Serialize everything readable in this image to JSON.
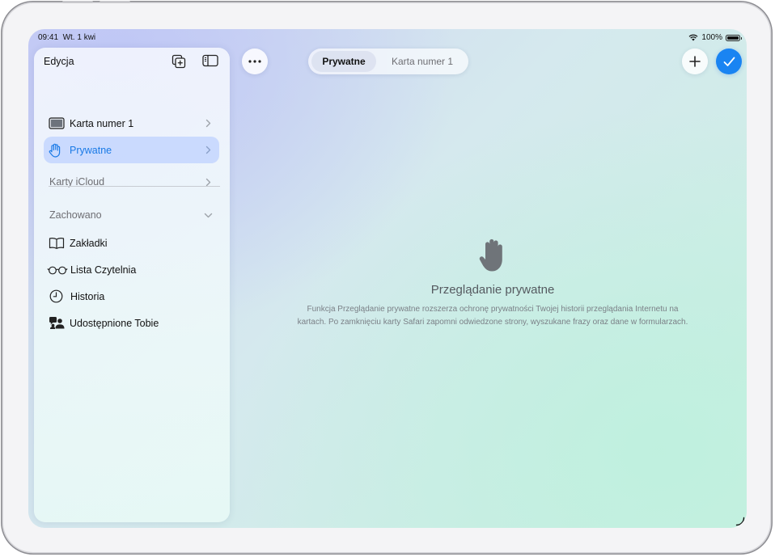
{
  "status_bar": {
    "time": "09:41",
    "date": "Wt. 1 kwi",
    "battery_percent": "100%",
    "battery_level": 1.0
  },
  "sidebar": {
    "edit_label": "Edycja",
    "tab_groups": [
      {
        "label": "Karta numer 1",
        "icon": "tablet-icon",
        "selected": false
      },
      {
        "label": "Prywatne",
        "icon": "hand-icon",
        "selected": true
      }
    ],
    "icloud_tabs_label": "Karty iCloud",
    "saved_section_label": "Zachowano",
    "saved_items": [
      {
        "label": "Zakładki",
        "icon": "book-icon"
      },
      {
        "label": "Lista Czytelnia",
        "icon": "glasses-icon"
      },
      {
        "label": "Historia",
        "icon": "clock-icon"
      },
      {
        "label": "Udostępnione Tobie",
        "icon": "shared-people-icon"
      }
    ]
  },
  "toolbar": {
    "segments": [
      "Prywatne",
      "Karta numer 1"
    ],
    "selected_segment": "Prywatne"
  },
  "empty_state": {
    "icon": "hand-icon",
    "title": "Przeglądanie prywatne",
    "body": "Funkcja Przeglądanie prywatne rozszerza ochronę prywatności Twojej historii przeglądania Internetu na kartach. Po zamknięciu karty Safari zapomni odwiedzone strony, wyszukane frazy oraz dane w formularzach."
  },
  "colors": {
    "accent": "#1a84f2",
    "selected_row_bg": "#c4d6ff",
    "selected_text": "#1a7ae6"
  }
}
